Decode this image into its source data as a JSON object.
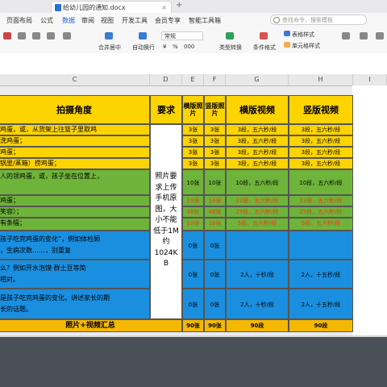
{
  "window": {
    "doc_tab_title": "给幼儿园的通知.docx",
    "tab_close": "×",
    "tab_add": "+"
  },
  "menu": {
    "items": [
      "页面布局",
      "公式",
      "数据",
      "审阅",
      "视图",
      "开发工具",
      "会员专享",
      "智能工具箱"
    ],
    "search_placeholder": "查找命令、搜索模板"
  },
  "toolbar": {
    "number_format": "常规",
    "merge_center": "合并居中",
    "wrap_text": "自动换行",
    "type_convert": "类型转换",
    "conditional_format": "条件格式",
    "table_style": "表格样式",
    "cell_style": "单元格样式",
    "symbols": [
      "¥",
      "%",
      "000"
    ]
  },
  "columns": [
    "C",
    "D",
    "E",
    "F",
    "G",
    "H",
    "I"
  ],
  "table": {
    "header": {
      "angle": "拍摄角度",
      "require": "要求",
      "landscape_photo": "横版照片",
      "portrait_photo": "竖版照片",
      "landscape_video": "横版视频",
      "portrait_video": "竖版视频"
    },
    "angle_rows": [
      "鸡蛋，或，从货架上往篮子里取鸡",
      "洗鸡蛋；",
      "鸡蛋；",
      "锅里/蒸箱）捞鸡蛋；",
      "人的领鸡蛋，或，孩子坐在位置上，",
      "鸡蛋；",
      "笑容）；",
      "有条幅；",
      "孩子吃完鸡蛋的变化”，例如体检顾",
      "，生病次数……，别重复",
      "么？例如开水泡馍·群土豆等简",
      "相对。",
      "是孩子吃完鸡蛋的变化，讲述家长的期",
      "长的话题。"
    ],
    "requirement_text": [
      "照片要",
      "求上传",
      "手机原",
      "图，大",
      "小不能",
      "低于1M",
      "约",
      "1024K",
      "B"
    ],
    "yellow_rows": [
      {
        "e": "3张",
        "f": "3张",
        "g": "3段，五六秒/段",
        "h": "3段，五六秒/段"
      },
      {
        "e": "3张",
        "f": "3张",
        "g": "3段，五六秒/段",
        "h": "3段，五六秒/段"
      },
      {
        "e": "3张",
        "f": "3张",
        "g": "3段，五六秒/段",
        "h": "3段，五六秒/段"
      },
      {
        "e": "3张",
        "f": "3张",
        "g": "3段，五六秒/段",
        "h": "3段，五六秒/段"
      }
    ],
    "green_rows": [
      {
        "e": "10张",
        "f": "10张",
        "g": "10段，五六秒/段",
        "h": "10段，五六秒/段"
      },
      {
        "e": "10张",
        "f": "10张",
        "g": "22段，五六秒/段",
        "h": "22段，五六秒/段"
      },
      {
        "e": "48张",
        "f": "48张",
        "g": "25段，五六秒/段",
        "h": "25段，五六秒/段"
      },
      {
        "e": "10张",
        "f": "10张",
        "g": "5段，五六秒/段",
        "h": "5段，五六秒/段"
      }
    ],
    "blue_rows": [
      {
        "e": "0张",
        "f": "0张",
        "g": "",
        "h": ""
      },
      {
        "e": "0张",
        "f": "0张",
        "g": "2人，十秒/段",
        "h": "2人，十五秒/段"
      },
      {
        "e": "0张",
        "f": "0张",
        "g": "2人，十秒/段",
        "h": "2人，十五秒/段"
      }
    ],
    "summary": {
      "label": "照片+视频汇总",
      "e": "90张",
      "f": "90张",
      "g": "90段",
      "h": "90段"
    }
  }
}
